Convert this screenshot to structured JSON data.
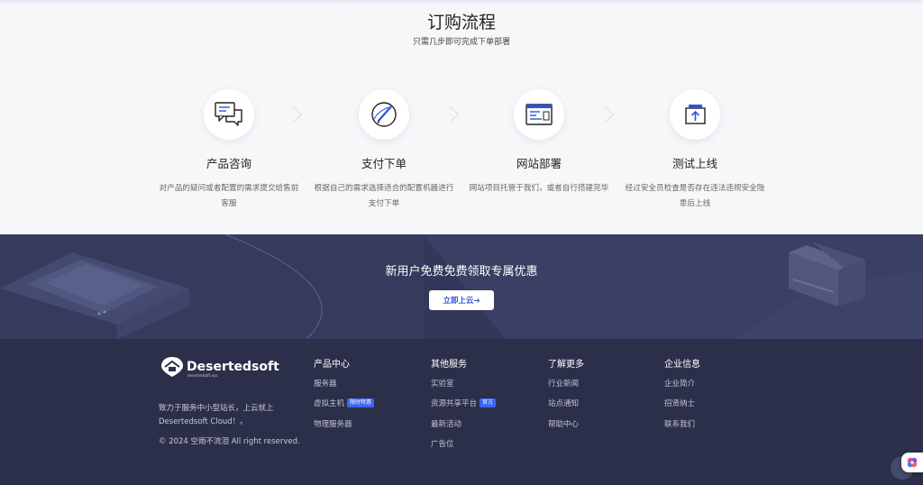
{
  "process": {
    "title": "订购流程",
    "subtitle": "只需几步即可完成下单部署",
    "steps": [
      {
        "icon": "chat-bubbles-icon",
        "name": "产品咨询",
        "desc": "对产品的疑问或者配置的需求提交给售前客服"
      },
      {
        "icon": "compass-pen-icon",
        "name": "支付下单",
        "desc": "根据自己的需求选择适合的配置机器进行支付下单"
      },
      {
        "icon": "browser-window-icon",
        "name": "网站部署",
        "desc": "网站项目托管于我们，或者自行搭建完毕"
      },
      {
        "icon": "upload-box-icon",
        "name": "测试上线",
        "desc": "经过安全员检查是否存在违法违规安全隐患后上线"
      }
    ]
  },
  "promo": {
    "title": "新用户免费免费领取专属优惠",
    "button": "立即上云➔"
  },
  "footer": {
    "logo_text": "Desertedsoft",
    "logo_domain": "desertedsoft.xyz",
    "slogan": "致力于服务中小型站长，上云就上Desertedsoft Cloud！。",
    "copyright": "©  2024 空雨不流泪 All right reserved.",
    "columns": [
      {
        "title": "产品中心",
        "items": [
          {
            "label": "服务器"
          },
          {
            "label": "虚拟主机",
            "tag": "限时特惠"
          },
          {
            "label": "物理服务器"
          }
        ]
      },
      {
        "title": "其他服务",
        "items": [
          {
            "label": "实验室"
          },
          {
            "label": "资源共享平台",
            "tag": "官方"
          },
          {
            "label": "最新活动"
          },
          {
            "label": "广告位"
          }
        ]
      },
      {
        "title": "了解更多",
        "items": [
          {
            "label": "行业新闻"
          },
          {
            "label": "站点通知"
          },
          {
            "label": "帮助中心"
          }
        ]
      },
      {
        "title": "企业信息",
        "items": [
          {
            "label": "企业简介"
          },
          {
            "label": "招贤纳士"
          },
          {
            "label": "联系我们"
          }
        ]
      }
    ]
  },
  "colors": {
    "accent": "#2b52d9",
    "promo_bg": "#33385a",
    "footer_bg": "#2c2f4a",
    "tag_bg": "#3b66f0"
  }
}
